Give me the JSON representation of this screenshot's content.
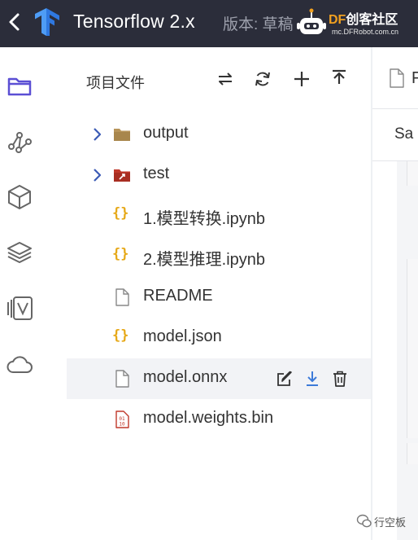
{
  "header": {
    "app_title": "Tensorflow 2.x",
    "version_label": "版本: 草稿",
    "brand": {
      "prefix": "DF",
      "suffix": "创客社区",
      "url": "mc.DFRobot.com.cn"
    }
  },
  "rail": {
    "items": [
      "folder-icon",
      "graph-icon",
      "cube-icon",
      "layers-icon",
      "version-icon",
      "cloud-icon"
    ]
  },
  "file_panel": {
    "title": "项目文件",
    "toolbar": [
      "swap-icon",
      "refresh-icon",
      "add-icon",
      "upload-icon"
    ],
    "files": [
      {
        "name": "output",
        "type": "folder"
      },
      {
        "name": "test",
        "type": "folder-shared"
      },
      {
        "name": "1.模型转换.ipynb",
        "type": "json"
      },
      {
        "name": "2.模型推理.ipynb",
        "type": "json"
      },
      {
        "name": "README",
        "type": "file"
      },
      {
        "name": "model.json",
        "type": "json"
      },
      {
        "name": "model.onnx",
        "type": "file"
      },
      {
        "name": "model.weights.bin",
        "type": "binary"
      }
    ]
  },
  "editor": {
    "tab_fragment": "F",
    "subtab_fragment": "Sa"
  },
  "watermark": {
    "text": "行空板"
  },
  "colors": {
    "topbar": "#2b2d3a",
    "accent": "#5b4fd4",
    "folder": "#b8955a",
    "json": "#e6a817",
    "binary": "#c0392b",
    "link": "#3d7bd9"
  }
}
